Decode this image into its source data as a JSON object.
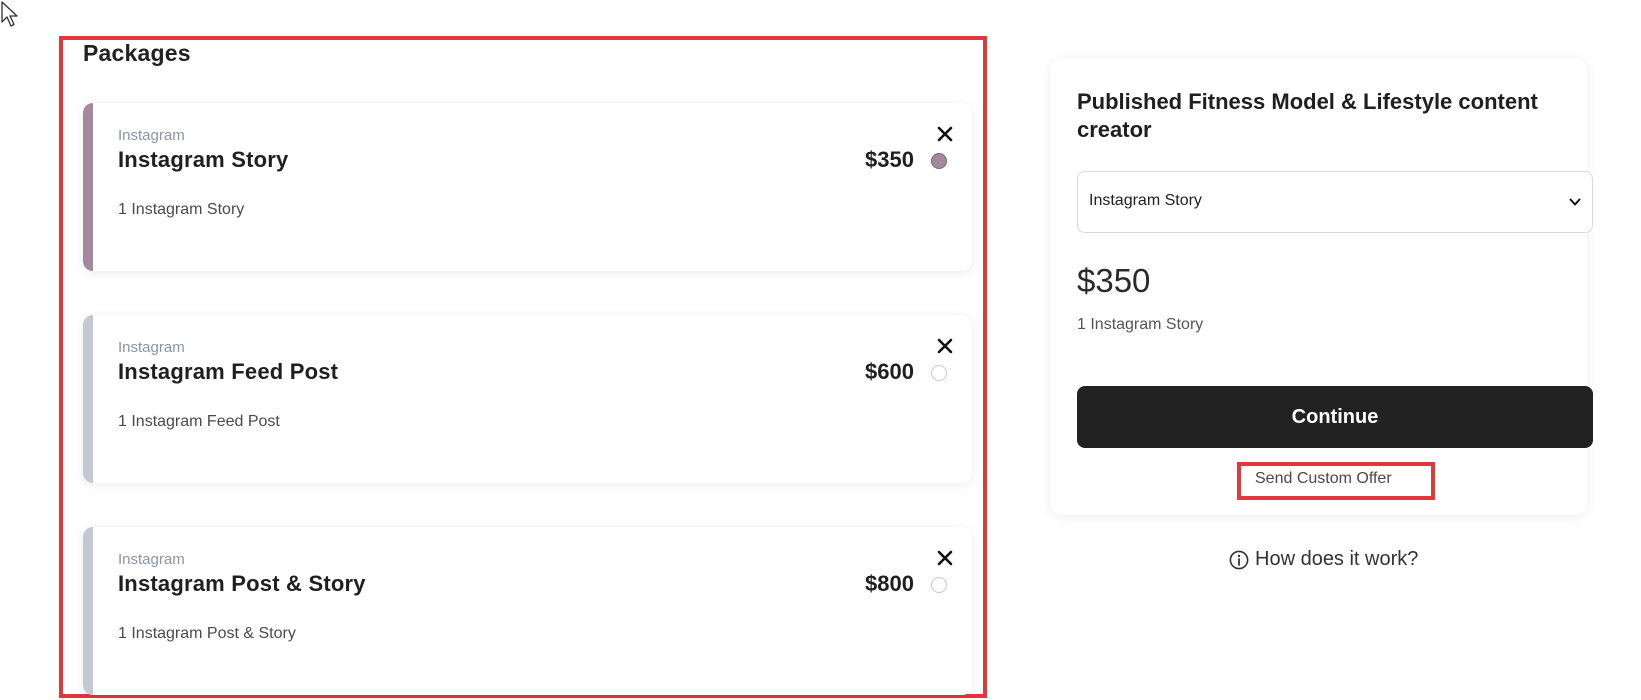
{
  "packages": {
    "title": "Packages",
    "items": [
      {
        "platform": "Instagram",
        "name": "Instagram Story",
        "price": "$350",
        "description": "1 Instagram Story",
        "selected": true
      },
      {
        "platform": "Instagram",
        "name": "Instagram Feed Post",
        "price": "$600",
        "description": "1 Instagram Feed Post",
        "selected": false
      },
      {
        "platform": "Instagram",
        "name": "Instagram Post & Story",
        "price": "$800",
        "description": "1 Instagram Post & Story",
        "selected": false
      }
    ]
  },
  "order": {
    "title": "Published Fitness Model & Lifestyle content creator",
    "selected_package": "Instagram Story",
    "price": "$350",
    "description": "1 Instagram Story",
    "continue_label": "Continue",
    "custom_offer_label": "Send Custom Offer"
  },
  "help": {
    "how_it_works_label": "How does it work?"
  },
  "colors": {
    "selected_accent": "#a4899e",
    "unselected_accent": "#c4c9d0",
    "primary_button": "#222222",
    "highlight_border": "#e0383c"
  }
}
